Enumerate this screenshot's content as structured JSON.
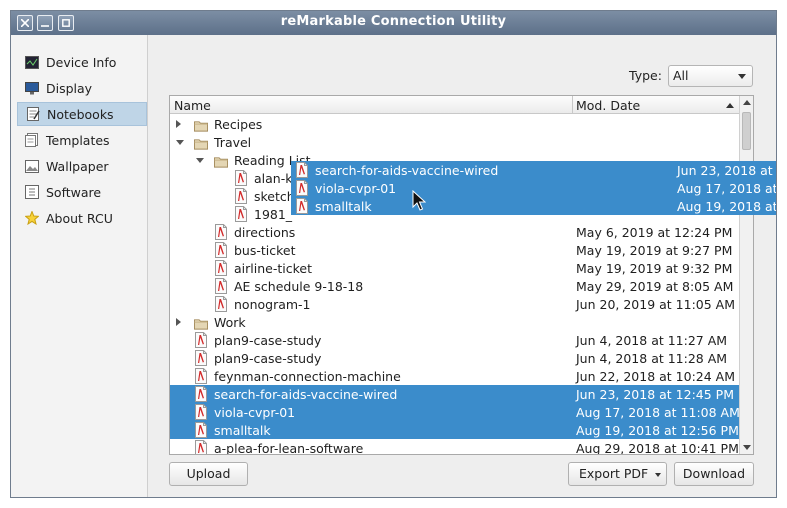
{
  "window": {
    "title": "reMarkable Connection Utility"
  },
  "colors": {
    "selection": "#3b8ccb",
    "titlebar": "#6a7d96",
    "sidebar_selected": "#bfd5e7"
  },
  "sidebar": {
    "items": [
      {
        "label": "Device Info",
        "icon": "device-info-icon"
      },
      {
        "label": "Display",
        "icon": "display-icon"
      },
      {
        "label": "Notebooks",
        "icon": "notebook-icon",
        "selected": true
      },
      {
        "label": "Templates",
        "icon": "templates-icon"
      },
      {
        "label": "Wallpaper",
        "icon": "wallpaper-icon"
      },
      {
        "label": "Software",
        "icon": "software-icon"
      },
      {
        "label": "About RCU",
        "icon": "star-icon"
      }
    ]
  },
  "filter": {
    "type_label": "Type:",
    "type_value": "All"
  },
  "list": {
    "columns": {
      "name": "Name",
      "date": "Mod. Date"
    },
    "rows": [
      {
        "name": "Recipes",
        "date": "",
        "kind": "folder",
        "depth": 0,
        "expander": "closed",
        "selected": false
      },
      {
        "name": "Travel",
        "date": "",
        "kind": "folder",
        "depth": 0,
        "expander": "open",
        "selected": false
      },
      {
        "name": "Reading List",
        "date": "",
        "kind": "folder",
        "depth": 1,
        "expander": "open",
        "selected": false
      },
      {
        "name": "alan-k",
        "date": "",
        "kind": "doc",
        "depth": 2,
        "expander": "",
        "selected": false
      },
      {
        "name": "sketch",
        "date": "",
        "kind": "doc",
        "depth": 2,
        "expander": "",
        "selected": false
      },
      {
        "name": "1981_",
        "date": "",
        "kind": "doc",
        "depth": 2,
        "expander": "",
        "selected": false
      },
      {
        "name": "directions",
        "date": "May 6, 2019 at 12:24 PM",
        "kind": "doc",
        "depth": 1,
        "expander": "",
        "selected": false
      },
      {
        "name": "bus-ticket",
        "date": "May 19, 2019 at 9:27 PM",
        "kind": "doc",
        "depth": 1,
        "expander": "",
        "selected": false
      },
      {
        "name": "airline-ticket",
        "date": "May 19, 2019 at 9:32 PM",
        "kind": "doc",
        "depth": 1,
        "expander": "",
        "selected": false
      },
      {
        "name": "AE schedule 9-18-18",
        "date": "May 29, 2019 at 8:05 AM",
        "kind": "doc",
        "depth": 1,
        "expander": "",
        "selected": false
      },
      {
        "name": "nonogram-1",
        "date": "Jun 20, 2019 at 11:05 AM",
        "kind": "doc",
        "depth": 1,
        "expander": "",
        "selected": false
      },
      {
        "name": "Work",
        "date": "",
        "kind": "folder",
        "depth": 0,
        "expander": "closed",
        "selected": false
      },
      {
        "name": "plan9-case-study",
        "date": "Jun 4, 2018 at 11:27 AM",
        "kind": "doc",
        "depth": 0,
        "expander": "",
        "selected": false
      },
      {
        "name": "plan9-case-study",
        "date": "Jun 4, 2018 at 11:28 AM",
        "kind": "doc",
        "depth": 0,
        "expander": "",
        "selected": false
      },
      {
        "name": "feynman-connection-machine",
        "date": "Jun 22, 2018 at 10:24 AM",
        "kind": "doc",
        "depth": 0,
        "expander": "",
        "selected": false
      },
      {
        "name": "search-for-aids-vaccine-wired",
        "date": "Jun 23, 2018 at 12:45 PM",
        "kind": "doc",
        "depth": 0,
        "expander": "",
        "selected": true
      },
      {
        "name": "viola-cvpr-01",
        "date": "Aug 17, 2018 at 11:08 AM",
        "kind": "doc",
        "depth": 0,
        "expander": "",
        "selected": true
      },
      {
        "name": "smalltalk",
        "date": "Aug 19, 2018 at 12:56 PM",
        "kind": "doc",
        "depth": 0,
        "expander": "",
        "selected": true
      },
      {
        "name": "a-plea-for-lean-software",
        "date": "Aug 29, 2018 at 10:41 PM",
        "kind": "doc",
        "depth": 0,
        "expander": "",
        "selected": false
      }
    ]
  },
  "drag_ghost": {
    "rows": [
      {
        "name": "search-for-aids-vaccine-wired",
        "date": "Jun 23, 2018 at 1"
      },
      {
        "name": "viola-cvpr-01",
        "date": "Aug 17, 2018 at"
      },
      {
        "name": "smalltalk",
        "date": "Aug 19, 2018 at"
      }
    ]
  },
  "buttons": {
    "upload": "Upload",
    "export": "Export PDF",
    "download": "Download"
  }
}
